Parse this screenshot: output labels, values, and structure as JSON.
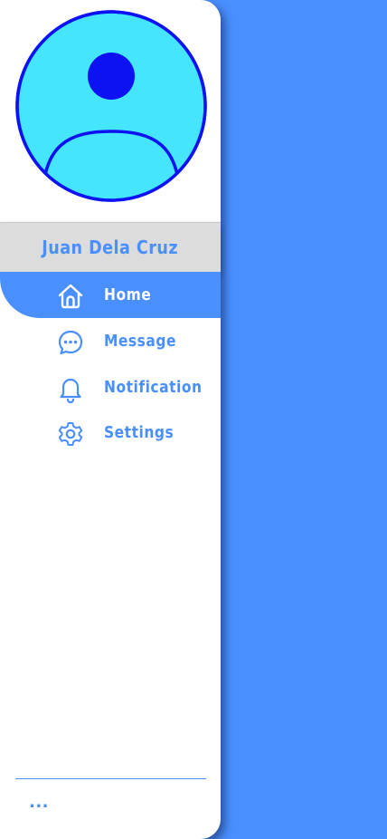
{
  "user": {
    "name": "Juan Dela Cruz",
    "avatar_icon": "user-avatar-icon"
  },
  "nav": {
    "items": [
      {
        "label": "Home",
        "icon": "home-icon",
        "active": true
      },
      {
        "label": "Message",
        "icon": "chat-bubble-icon",
        "active": false
      },
      {
        "label": "Notification",
        "icon": "bell-icon",
        "active": false
      },
      {
        "label": "Settings",
        "icon": "gear-icon",
        "active": false
      }
    ]
  },
  "footer": {
    "more_label": "..."
  },
  "colors": {
    "accent": "#4a8ffe",
    "avatar_fill": "#45e5fd",
    "avatar_stroke": "#0c12f2",
    "name_bar": "#dcdcdc",
    "drawer": "#ffffff"
  }
}
